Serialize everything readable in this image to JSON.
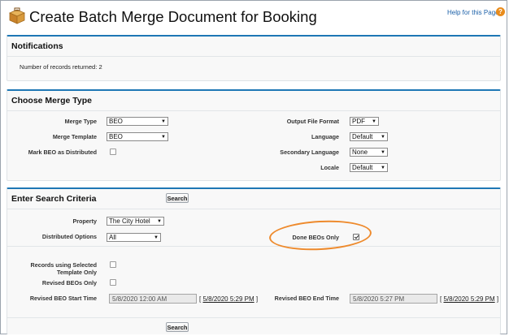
{
  "header": {
    "title": "Create Batch Merge Document for Booking",
    "help_link": "Help for this Page",
    "help_icon_glyph": "?",
    "accent_color": "#1e77b5"
  },
  "notifications": {
    "title": "Notifications",
    "records_text": "Number of records returned: 2"
  },
  "merge_type": {
    "title": "Choose Merge Type",
    "merge_type_label": "Merge Type",
    "merge_type_value": "BEO",
    "merge_template_label": "Merge Template",
    "merge_template_value": "BEO",
    "mark_distributed_label": "Mark BEO as Distributed",
    "mark_distributed_checked": false,
    "output_format_label": "Output File Format",
    "output_format_value": "PDF",
    "language_label": "Language",
    "language_value": "Default",
    "secondary_language_label": "Secondary Language",
    "secondary_language_value": "None",
    "locale_label": "Locale",
    "locale_value": "Default"
  },
  "search": {
    "title": "Enter Search Criteria",
    "search_button": "Search",
    "property_label": "Property",
    "property_value": "The City Hotel",
    "distributed_options_label": "Distributed Options",
    "distributed_options_value": "All",
    "done_beos_label": "Done BEOs Only",
    "done_beos_checked": true,
    "records_selected_label_line1": "Records using Selected",
    "records_selected_label_line2": "Template Only",
    "records_selected_checked": false,
    "revised_beos_label": "Revised BEOs Only",
    "revised_beos_checked": false,
    "start_time_label": "Revised BEO Start Time",
    "start_time_value": "5/8/2020 12:00 AM",
    "start_time_link": "5/8/2020 5:29 PM",
    "end_time_label": "Revised BEO End Time",
    "end_time_value": "5/8/2020 5:27 PM",
    "end_time_link": "5/8/2020 5:29 PM",
    "bracket_open": "[",
    "bracket_close": "]",
    "highlight_color": "#ee8a2c"
  },
  "icons": {
    "page_icon": "briefcase-icon",
    "dropdown_arrow": "▼"
  }
}
